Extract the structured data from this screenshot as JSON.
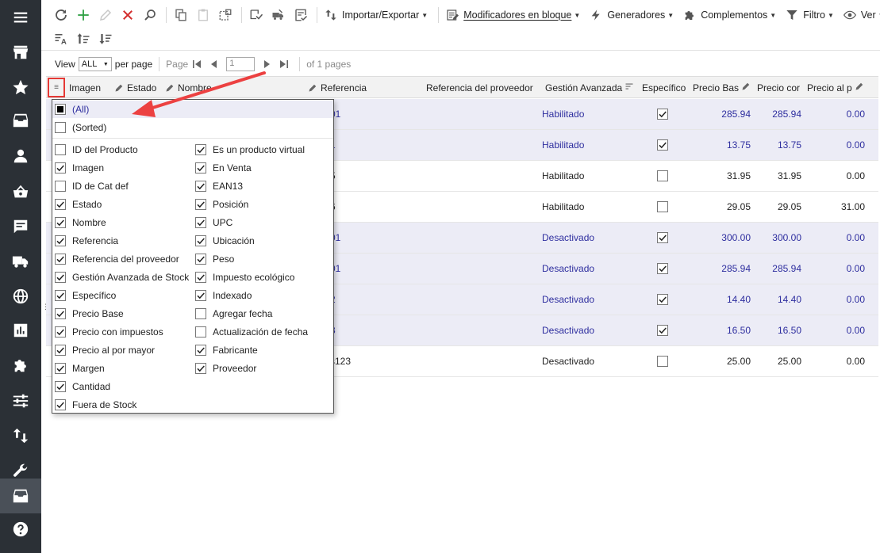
{
  "toolbar": {
    "import_export_label": "Importar/Exportar",
    "bulk_modifiers_label": "Modificadores en bloque",
    "generators_label": "Generadores",
    "addons_label": "Complementos",
    "filter_label": "Filtro",
    "view_label": "Ver"
  },
  "pager": {
    "view_label": "View",
    "view_value": "ALL",
    "per_page_label": "per page",
    "page_label": "Page",
    "page_value": "1",
    "of_pages_label": "of 1 pages"
  },
  "grid": {
    "columns": {
      "imagen": "Imagen",
      "estado": "Estado",
      "nombre": "Nombre",
      "referencia": "Referencia",
      "ref_proveedor": "Referencia del proveedor",
      "gestion": "Gestión Avanzada",
      "especifico": "Específico",
      "precio_base": "Precio Bas",
      "precio_con": "Precio cor",
      "precio_al": "Precio al p"
    },
    "rows": [
      {
        "ref": "01",
        "gestion": "Habilitado",
        "especifico": true,
        "precio_base": "285.94",
        "precio_con": "285.94",
        "precio_al": "0.00",
        "highlight": true
      },
      {
        "ref": "1",
        "gestion": "Habilitado",
        "especifico": true,
        "precio_base": "13.75",
        "precio_con": "13.75",
        "precio_al": "0.00",
        "highlight": true
      },
      {
        "ref": "5",
        "gestion": "Habilitado",
        "especifico": false,
        "precio_base": "31.95",
        "precio_con": "31.95",
        "precio_al": "0.00",
        "highlight": false
      },
      {
        "ref": "6",
        "gestion": "Habilitado",
        "especifico": false,
        "precio_base": "29.05",
        "precio_con": "29.05",
        "precio_al": "31.00",
        "highlight": false
      },
      {
        "ref": "01",
        "gestion": "Desactivado",
        "especifico": true,
        "precio_base": "300.00",
        "precio_con": "300.00",
        "precio_al": "0.00",
        "highlight": true
      },
      {
        "ref": "01",
        "gestion": "Desactivado",
        "especifico": true,
        "precio_base": "285.94",
        "precio_con": "285.94",
        "precio_al": "0.00",
        "highlight": true
      },
      {
        "ref": "2",
        "gestion": "Desactivado",
        "especifico": true,
        "precio_base": "14.40",
        "precio_con": "14.40",
        "precio_al": "0.00",
        "highlight": true
      },
      {
        "ref": "3",
        "gestion": "Desactivado",
        "especifico": true,
        "precio_base": "16.50",
        "precio_con": "16.50",
        "precio_al": "0.00",
        "highlight": true
      },
      {
        "ref": "s123",
        "gestion": "Desactivado",
        "especifico": false,
        "precio_base": "25.00",
        "precio_con": "25.00",
        "precio_al": "0.00",
        "highlight": false
      }
    ]
  },
  "column_menu": {
    "all_label": "(All)",
    "sorted_label": "(Sorted)",
    "left_items": [
      {
        "label": "ID del Producto",
        "checked": false
      },
      {
        "label": "Imagen",
        "checked": true
      },
      {
        "label": "ID de Cat def",
        "checked": false
      },
      {
        "label": "Estado",
        "checked": true
      },
      {
        "label": "Nombre",
        "checked": true
      },
      {
        "label": "Referencia",
        "checked": true
      },
      {
        "label": "Referencia del proveedor",
        "checked": true
      },
      {
        "label": "Gestión Avanzada de Stock",
        "checked": true
      },
      {
        "label": "Específico",
        "checked": true
      },
      {
        "label": "Precio Base",
        "checked": true
      },
      {
        "label": "Precio con impuestos",
        "checked": true
      },
      {
        "label": "Precio al por mayor",
        "checked": true
      },
      {
        "label": "Margen",
        "checked": true
      },
      {
        "label": "Cantidad",
        "checked": true
      },
      {
        "label": "Fuera de Stock",
        "checked": true
      }
    ],
    "right_items": [
      {
        "label": "Es un producto virtual",
        "checked": true
      },
      {
        "label": "En Venta",
        "checked": true
      },
      {
        "label": "EAN13",
        "checked": true
      },
      {
        "label": "Posición",
        "checked": true
      },
      {
        "label": "UPC",
        "checked": true
      },
      {
        "label": "Ubicación",
        "checked": true
      },
      {
        "label": "Peso",
        "checked": true
      },
      {
        "label": "Impuesto ecológico",
        "checked": true
      },
      {
        "label": "Indexado",
        "checked": true
      },
      {
        "label": "Agregar fecha",
        "checked": false
      },
      {
        "label": "Actualización de fecha",
        "checked": false
      },
      {
        "label": "Fabricante",
        "checked": true
      },
      {
        "label": "Proveedor",
        "checked": true
      }
    ]
  },
  "colors": {
    "sidebar_bg": "#2b3036",
    "accent_blue": "#2e2e9f",
    "highlight_row": "#ececf6",
    "annotation_red": "#e53935",
    "add_green": "#2ea043",
    "delete_red": "#d32f2f"
  },
  "icons": {
    "sidebar": [
      "hamburger-icon",
      "store-icon",
      "star-icon",
      "inbox-icon",
      "user-icon",
      "basket-icon",
      "chat-icon",
      "truck-icon",
      "globe-icon",
      "chart-icon",
      "puzzle-icon",
      "sliders-icon",
      "arrows-updown-icon",
      "wrench-icon",
      "catalog-icon",
      "help-icon"
    ]
  }
}
